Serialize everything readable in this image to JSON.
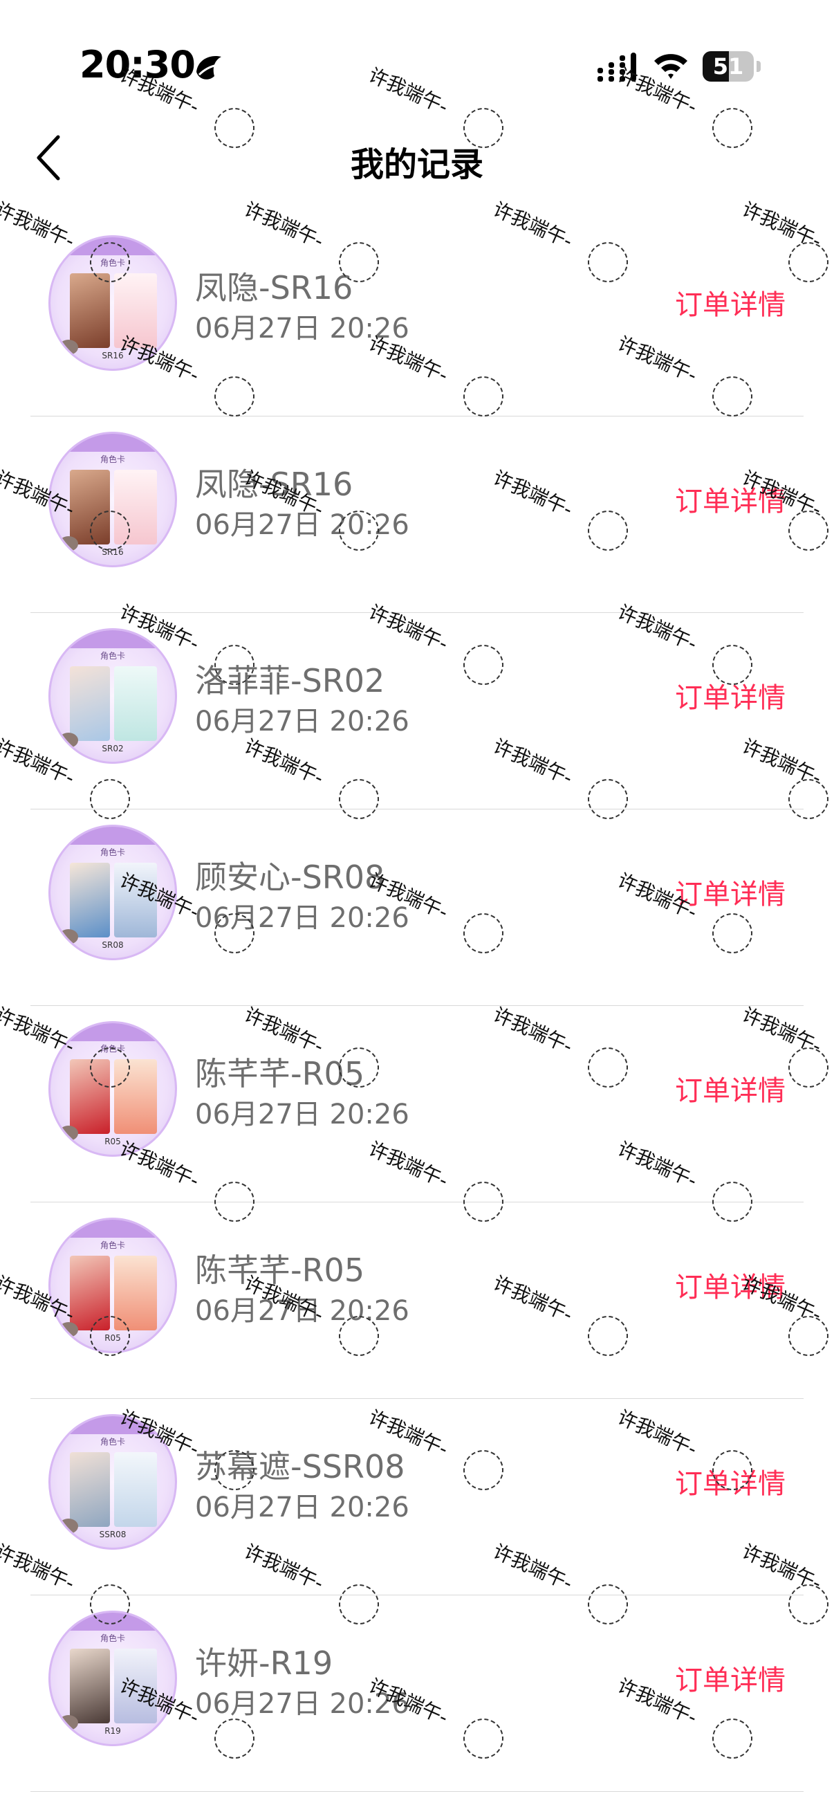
{
  "status_bar": {
    "time": "20:30",
    "battery": "51",
    "battery_level": 0.51
  },
  "nav": {
    "title": "我的记录"
  },
  "thumbnail": {
    "header": "角色卡"
  },
  "records": [
    {
      "name": "凤隐-SR16",
      "date": "06月27日 20:26",
      "code": "SR16",
      "action": "订单详情"
    },
    {
      "name": "凤隐-SR16",
      "date": "06月27日 20:26",
      "code": "SR16",
      "action": "订单详情"
    },
    {
      "name": "洛菲菲-SR02",
      "date": "06月27日 20:26",
      "code": "SR02",
      "action": "订单详情"
    },
    {
      "name": "顾安心-SR08",
      "date": "06月27日 20:26",
      "code": "SR08",
      "action": "订单详情"
    },
    {
      "name": "陈芊芊-R05",
      "date": "06月27日 20:26",
      "code": "R05",
      "action": "订单详情"
    },
    {
      "name": "陈芊芊-R05",
      "date": "06月27日 20:26",
      "code": "R05",
      "action": "订单详情"
    },
    {
      "name": "苏幕遮-SSR08",
      "date": "06月27日 20:26",
      "code": "SSR08",
      "action": "订单详情"
    },
    {
      "name": "许妍-R19",
      "date": "06月27日 20:26",
      "code": "R19",
      "action": "订单详情"
    }
  ],
  "watermark": {
    "text": "许我端午-"
  },
  "colors": {
    "accent": "#ff2d55",
    "text_secondary": "#6e6e6e"
  }
}
